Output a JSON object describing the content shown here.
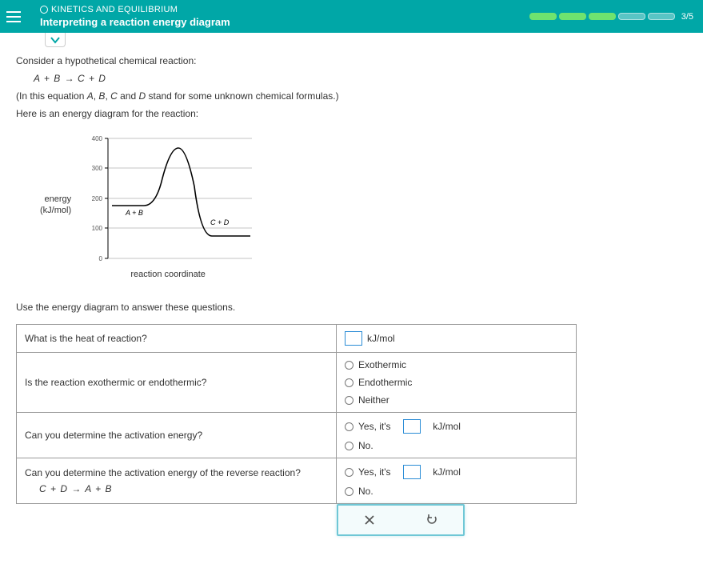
{
  "header": {
    "category": "KINETICS AND EQUILIBRIUM",
    "title": "Interpreting a reaction energy diagram",
    "progress": "3/5"
  },
  "intro": {
    "consider": "Consider a hypothetical chemical reaction:",
    "equation_left": "A + B",
    "equation_right": "C + D",
    "explain": "(In this equation A, B, C and D stand for some unknown chemical formulas.)",
    "here_is": "Here is an energy diagram for the reaction:"
  },
  "graph": {
    "ylabel_top": "energy",
    "ylabel_bottom": "(kJ/mol)",
    "xlabel": "reaction coordinate",
    "left_label": "A + B",
    "right_label": "C + D",
    "ticks": {
      "t0": "0",
      "t100": "100",
      "t200": "200",
      "t300": "300",
      "t400": "400"
    }
  },
  "use_line": "Use the energy diagram to answer these questions.",
  "questions": {
    "q1": "What is the heat of reaction?",
    "q1_unit": "kJ/mol",
    "q2": "Is the reaction exothermic or endothermic?",
    "q2_opts": {
      "a": "Exothermic",
      "b": "Endothermic",
      "c": "Neither"
    },
    "q3": "Can you determine the activation energy?",
    "q3_yes": "Yes,  it's",
    "q3_unit": "kJ/mol",
    "q3_no": "No.",
    "q4": "Can you determine the activation energy of the reverse reaction?",
    "q4_sub_left": "C + D",
    "q4_sub_right": "A + B",
    "q4_yes": "Yes,  it's",
    "q4_unit": "kJ/mol",
    "q4_no": "No."
  },
  "chart_data": {
    "type": "line",
    "title": "Energy diagram",
    "xlabel": "reaction coordinate",
    "ylabel": "energy (kJ/mol)",
    "ylim": [
      0,
      400
    ],
    "yticks": [
      0,
      100,
      200,
      300,
      400
    ],
    "reactants_energy": 175,
    "products_energy": 75,
    "transition_state_energy": 360,
    "series": [
      {
        "name": "energy",
        "x": [
          0,
          0.22,
          0.35,
          0.45,
          0.55,
          0.65,
          0.78,
          1.0
        ],
        "values": [
          175,
          175,
          230,
          360,
          360,
          180,
          75,
          75
        ]
      }
    ],
    "annotations": [
      {
        "text": "A + B",
        "x": 0.14,
        "y": 160
      },
      {
        "text": "C + D",
        "x": 0.72,
        "y": 100
      }
    ]
  }
}
